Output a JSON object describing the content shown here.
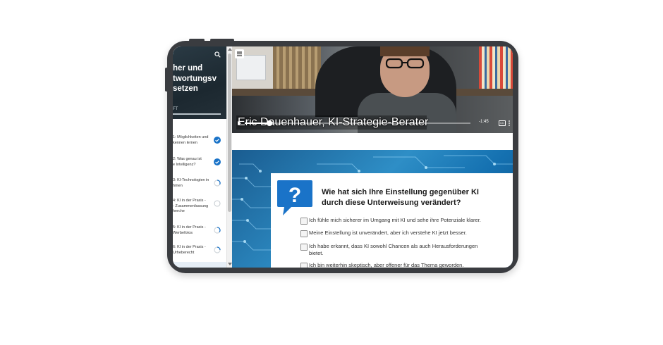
{
  "sidebar": {
    "title_lines": [
      "her und",
      "twortungsv",
      "setzen"
    ],
    "subtitle": "FT",
    "items": [
      {
        "label": "1: Möglichkeiten und\nkennen lernen",
        "status": "complete"
      },
      {
        "label": "2: Was genau ist\ne Intelligenz?",
        "status": "complete"
      },
      {
        "label": "3: KI-Technologien in\nhmen",
        "status": "in-progress"
      },
      {
        "label": "4: KI in der Praxis -\n- Zusammenfassung\nherche",
        "status": "not-started"
      },
      {
        "label": "5: KI in der Praxis -\nWerbefotos",
        "status": "in-progress"
      },
      {
        "label": "6: KI in der Praxis -\nUrheberecht",
        "status": "in-progress"
      }
    ]
  },
  "video": {
    "caption": "Eric Dauenhauer, KI-Strategie-Berater",
    "time_remaining": "-1:45",
    "progress": 0.11,
    "cc_label": "CC"
  },
  "quiz": {
    "question": "Wie hat sich Ihre Einstellung gegenüber KI durch diese Unterweisung verändert?",
    "options": [
      "Ich fühle mich sicherer im Umgang mit KI und sehe ihre Potenziale klarer.",
      "Meine Einstellung ist unverändert, aber ich verstehe KI jetzt besser.",
      "Ich habe erkannt, dass KI sowohl Chancen als auch Herausforderungen bietet.",
      "Ich bin weiterhin skeptisch, aber offener für das Thema geworden."
    ]
  },
  "colors": {
    "accent": "#1a73c8",
    "device": "#3a3c40",
    "quiz_bg": "#2e8ec6"
  }
}
